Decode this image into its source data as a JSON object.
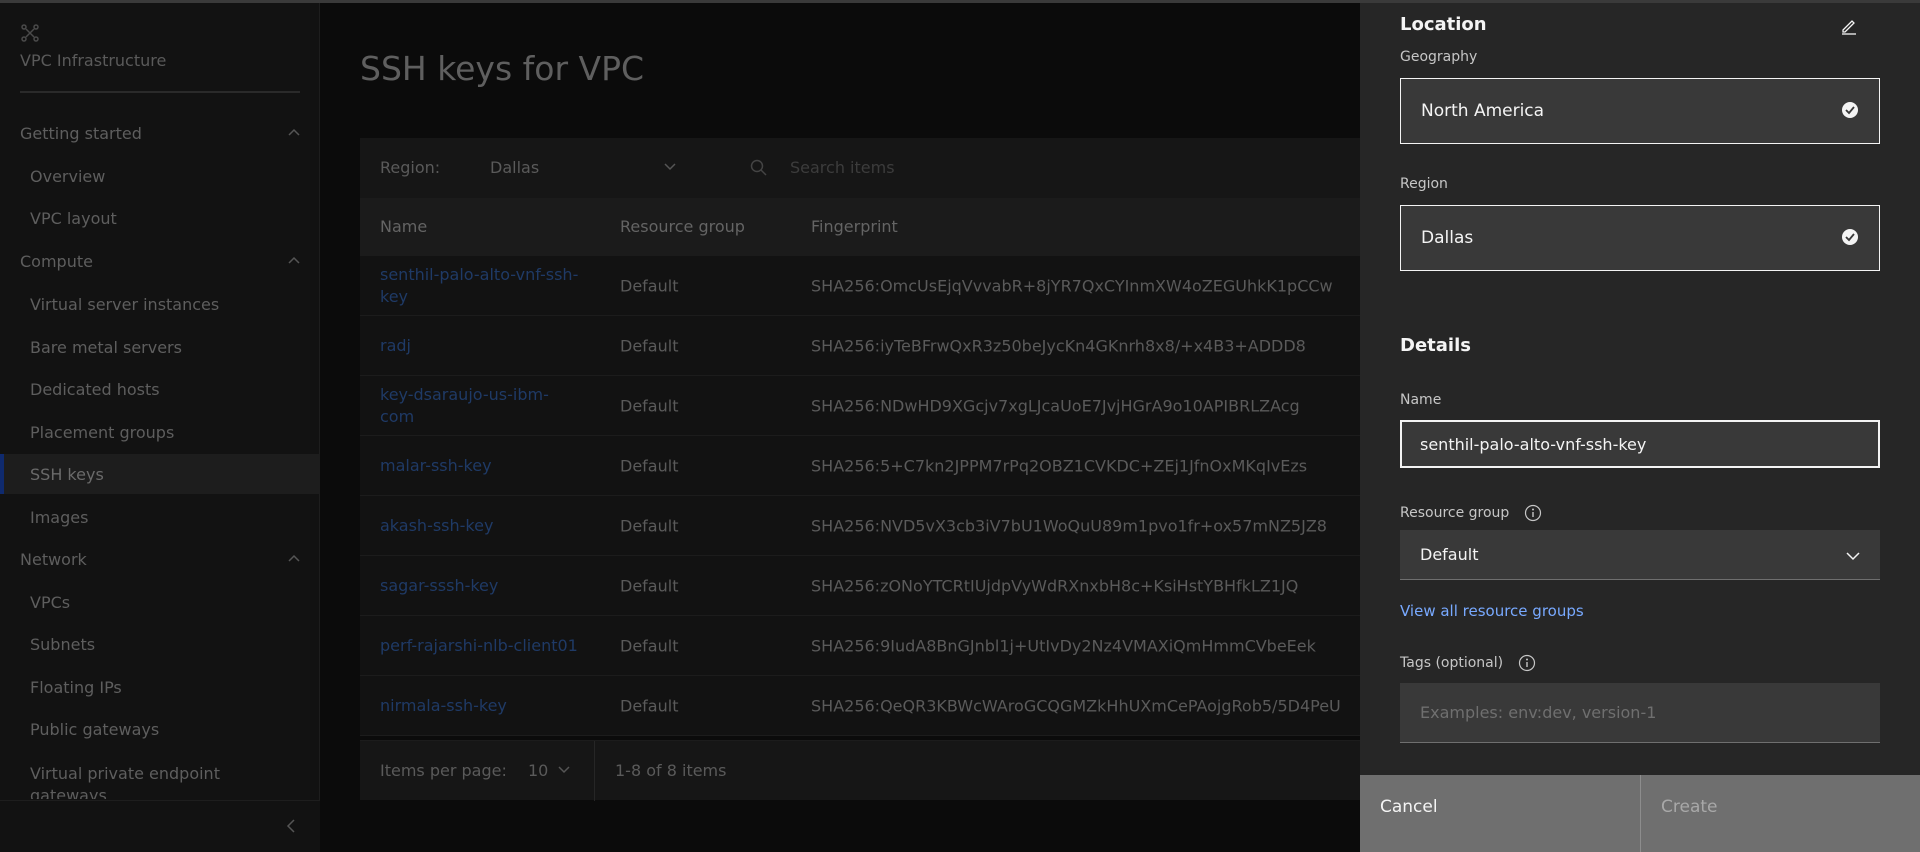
{
  "sidebar": {
    "title": "VPC Infrastructure",
    "sections": [
      {
        "label": "Getting started",
        "items": [
          "Overview",
          "VPC layout"
        ]
      },
      {
        "label": "Compute",
        "items": [
          "Virtual server instances",
          "Bare metal servers",
          "Dedicated hosts",
          "Placement groups",
          "SSH keys",
          "Images"
        ]
      },
      {
        "label": "Network",
        "items": [
          "VPCs",
          "Subnets",
          "Floating IPs",
          "Public gateways",
          "Virtual private endpoint gateways"
        ]
      }
    ],
    "active_item": "SSH keys"
  },
  "main": {
    "title": "SSH keys for VPC",
    "toolbar": {
      "region_label": "Region:",
      "region_value": "Dallas",
      "search_placeholder": "Search items"
    },
    "table": {
      "columns": [
        "Name",
        "Resource group",
        "Fingerprint"
      ],
      "rows": [
        {
          "name": "senthil-palo-alto-vnf-ssh-key",
          "resource_group": "Default",
          "fingerprint": "SHA256:OmcUsEjqVvvabR+8jYR7QxCYInmXW4oZEGUhkK1pCCw"
        },
        {
          "name": "radj",
          "resource_group": "Default",
          "fingerprint": "SHA256:iyTeBFrwQxR3z50beJycKn4GKnrh8x8/+x4B3+ADDD8"
        },
        {
          "name": "key-dsaraujo-us-ibm-com",
          "resource_group": "Default",
          "fingerprint": "SHA256:NDwHD9XGcjv7xgLJcaUoE7JvjHGrA9o10APIBRLZAcg"
        },
        {
          "name": "malar-ssh-key",
          "resource_group": "Default",
          "fingerprint": "SHA256:5+C7kn2JPPM7rPq2OBZ1CVKDC+ZEj1JfnOxMKqIvEzs"
        },
        {
          "name": "akash-ssh-key",
          "resource_group": "Default",
          "fingerprint": "SHA256:NVD5vX3cb3iV7bU1WoQuU89m1pvo1fr+ox57mNZ5JZ8"
        },
        {
          "name": "sagar-sssh-key",
          "resource_group": "Default",
          "fingerprint": "SHA256:zONoYTCRtIUjdpVyWdRXnxbH8c+KsiHstYBHfkLZ1JQ"
        },
        {
          "name": "perf-rajarshi-nlb-client01",
          "resource_group": "Default",
          "fingerprint": "SHA256:9IudA8BnGJnbl1j+UtIvDy2Nz4VMAXiQmHmmCVbeEek"
        },
        {
          "name": "nirmala-ssh-key",
          "resource_group": "Default",
          "fingerprint": "SHA256:QeQR3KBWcWAroGCQGMZkHhUXmCePAojgRob5/5D4PeU"
        }
      ]
    },
    "pagination": {
      "label": "Items per page:",
      "per_page": "10",
      "range": "1-8 of 8 items"
    }
  },
  "panel": {
    "location_title": "Location",
    "geography_label": "Geography",
    "geography_value": "North America",
    "region_label": "Region",
    "region_value": "Dallas",
    "details_title": "Details",
    "name_label": "Name",
    "name_value": "senthil-palo-alto-vnf-ssh-key",
    "resource_group_label": "Resource group",
    "resource_group_value": "Default",
    "view_all_link": "View all resource groups",
    "tags_label": "Tags (optional)",
    "tags_placeholder": "Examples: env:dev, version-1",
    "cancel_label": "Cancel",
    "create_label": "Create"
  },
  "colors": {
    "panel_bg": "#262626",
    "field_bg": "#393939",
    "link": "#78a9ff",
    "active_marker": "#0f62fe"
  }
}
